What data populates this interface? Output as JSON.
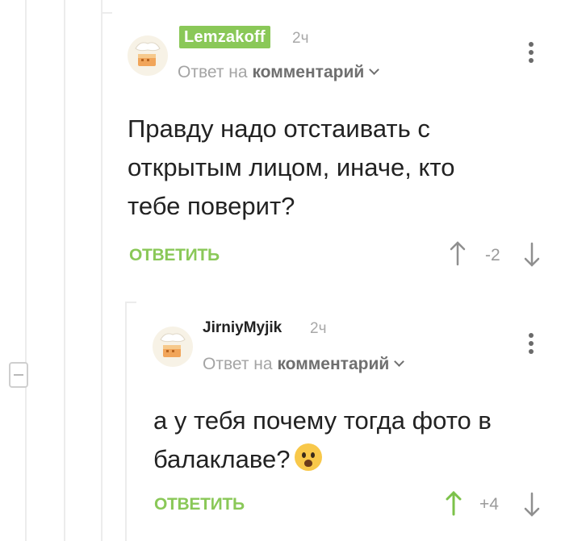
{
  "comments": [
    {
      "author": "Lemzakoff",
      "time": "2ч",
      "reply_prefix": "Ответ на",
      "reply_target": "комментарий",
      "text": "Правду надо отстаивать с открытым лицом, иначе, кто тебе поверит?",
      "reply_label": "ОТВЕТИТЬ",
      "score": "-2",
      "avatar_icon": "cake-avatar-icon"
    },
    {
      "author": "JirniyMyjik",
      "time": "2ч",
      "reply_prefix": "Ответ на",
      "reply_target": "комментарий",
      "text": "а у тебя почему тогда фото в балаклаве?",
      "reply_label": "ОТВЕТИТЬ",
      "score": "+4",
      "avatar_icon": "cake-avatar-icon",
      "emoji": "frowning-face-emoji"
    }
  ],
  "colors": {
    "accent_green": "#8ac858",
    "upvote_active": "#7cc24a",
    "muted": "#a4a4a4"
  }
}
